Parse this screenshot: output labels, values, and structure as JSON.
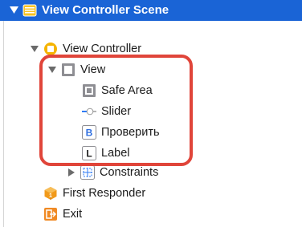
{
  "tree": {
    "scene": {
      "label": "View Controller Scene",
      "icon": "storyboard-scene-icon"
    },
    "view_controller": {
      "label": "View Controller",
      "icon": "view-controller-icon"
    },
    "view": {
      "label": "View",
      "icon": "view-icon"
    },
    "safe_area": {
      "label": "Safe Area",
      "icon": "safe-area-icon"
    },
    "slider": {
      "label": "Slider",
      "icon": "slider-icon"
    },
    "button": {
      "label": "Проверить",
      "icon": "button-icon",
      "glyph": "B"
    },
    "label": {
      "label": "Label",
      "icon": "label-icon",
      "glyph": "L"
    },
    "constraints": {
      "label": "Constraints",
      "icon": "constraints-icon"
    },
    "first_responder": {
      "label": "First Responder",
      "icon": "first-responder-icon"
    },
    "exit": {
      "label": "Exit",
      "icon": "exit-icon"
    }
  },
  "colors": {
    "selection": "#1a64d6",
    "highlight_border": "#e0453a",
    "vc_icon": "#f5b400",
    "cube_icon": "#f19a1b",
    "exit_icon": "#f08a24"
  }
}
